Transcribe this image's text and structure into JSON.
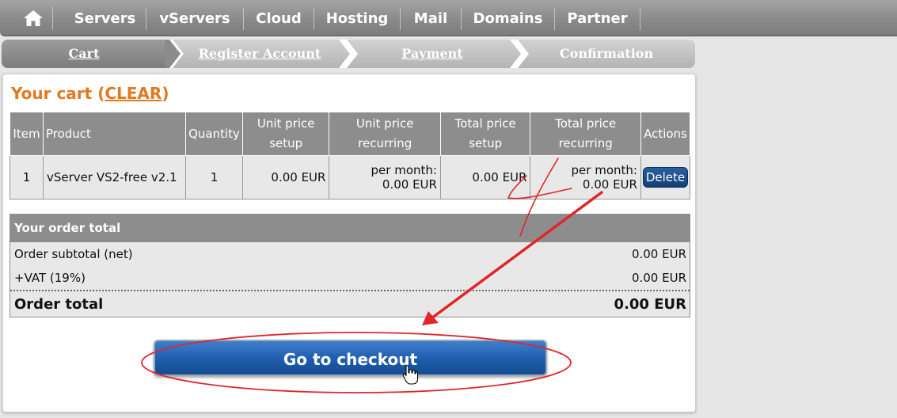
{
  "nav": {
    "home_icon": "home-icon",
    "items": [
      "Servers",
      "vServers",
      "Cloud",
      "Hosting",
      "Mail",
      "Domains",
      "Partner"
    ]
  },
  "steps": [
    "Cart",
    "Register Account",
    "Payment",
    "Confirmation"
  ],
  "cart": {
    "title_prefix": "Your cart (",
    "clear_label": "CLEAR",
    "title_suffix": ")",
    "headers": [
      "Item",
      "Product",
      "Quantity",
      "Unit price setup",
      "Unit price recurring",
      "Total price setup",
      "Total price recurring",
      "Actions"
    ],
    "rows": [
      {
        "item": "1",
        "product": "vServer VS2-free v2.1",
        "quantity": "1",
        "unit_setup": "0.00 EUR",
        "unit_recurring_period": "per month:",
        "unit_recurring_value": "0.00 EUR",
        "total_setup": "0.00 EUR",
        "total_recurring_period": "per month:",
        "total_recurring_value": "0.00 EUR",
        "action_label": "Delete"
      }
    ]
  },
  "totals": {
    "heading": "Your order total",
    "subtotal_label": "Order subtotal (net)",
    "subtotal_value": "0.00 EUR",
    "vat_label": "+VAT (19%)",
    "vat_value": "0.00 EUR",
    "total_label": "Order total",
    "total_value": "0.00 EUR"
  },
  "checkout_label": "Go to checkout",
  "colors": {
    "accent_orange": "#e07a1e",
    "button_blue": "#1c5aa8",
    "annotation_red": "#e0262b"
  }
}
